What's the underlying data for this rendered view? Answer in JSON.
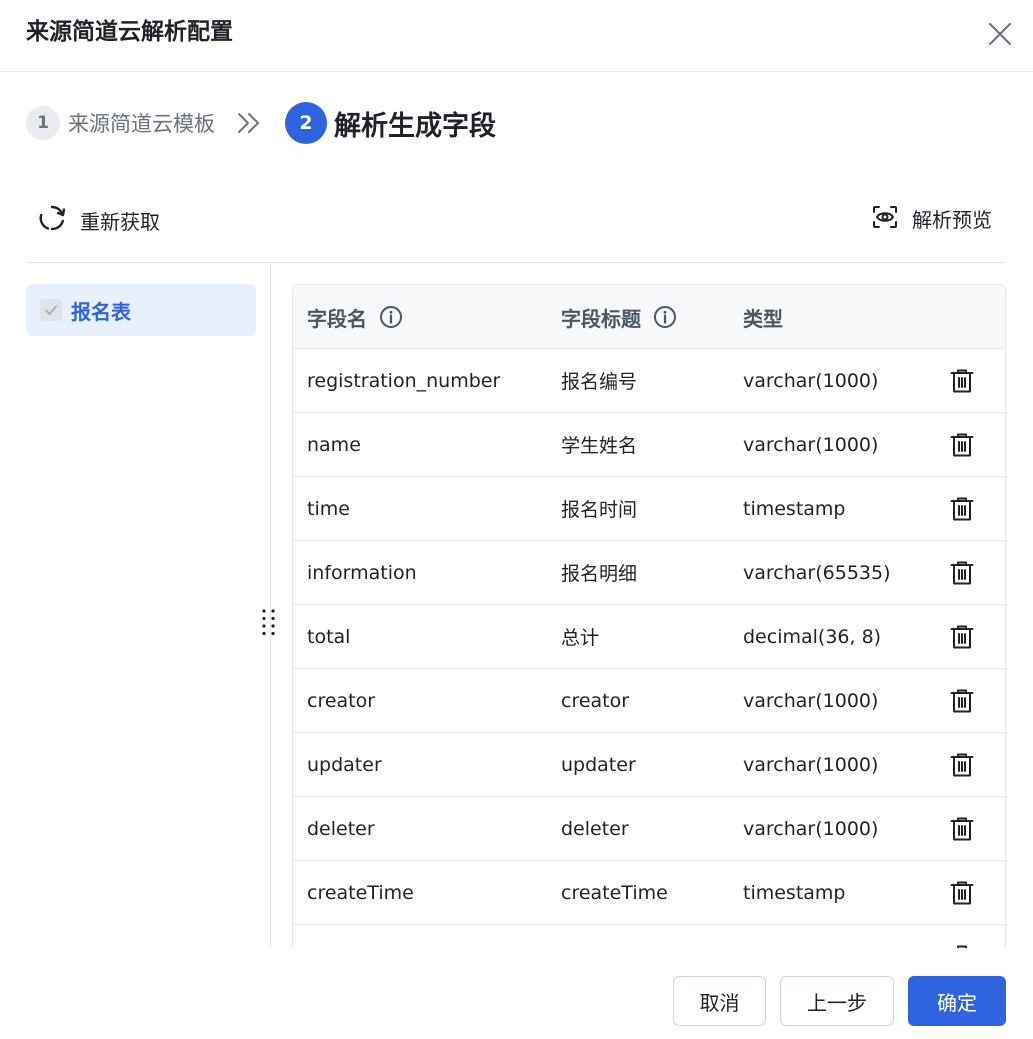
{
  "dialog": {
    "title": "来源简道云解析配置"
  },
  "steps": [
    {
      "number": "1",
      "label": "来源简道云模板"
    },
    {
      "number": "2",
      "label": "解析生成字段"
    }
  ],
  "toolbar": {
    "refresh_label": "重新获取",
    "preview_label": "解析预览"
  },
  "sidebar": {
    "items": [
      {
        "label": "报名表",
        "checked": true
      }
    ]
  },
  "table": {
    "headers": {
      "name": "字段名",
      "title": "字段标题",
      "type": "类型"
    },
    "rows": [
      {
        "name": "registration_number",
        "title": "报名编号",
        "type": "varchar(1000)"
      },
      {
        "name": "name",
        "title": "学生姓名",
        "type": "varchar(1000)"
      },
      {
        "name": "time",
        "title": "报名时间",
        "type": "timestamp"
      },
      {
        "name": "information",
        "title": "报名明细",
        "type": "varchar(65535)"
      },
      {
        "name": "total",
        "title": "总计",
        "type": "decimal(36, 8)"
      },
      {
        "name": "creator",
        "title": "creator",
        "type": "varchar(1000)"
      },
      {
        "name": "updater",
        "title": "updater",
        "type": "varchar(1000)"
      },
      {
        "name": "deleter",
        "title": "deleter",
        "type": "varchar(1000)"
      },
      {
        "name": "createTime",
        "title": "createTime",
        "type": "timestamp"
      }
    ]
  },
  "footer": {
    "cancel_label": "取消",
    "prev_label": "上一步",
    "confirm_label": "确定"
  },
  "colors": {
    "primary": "#2f63e0",
    "selected_bg": "#e8effd",
    "header_bg": "#f7f8fa",
    "border": "#e5e7eb"
  }
}
